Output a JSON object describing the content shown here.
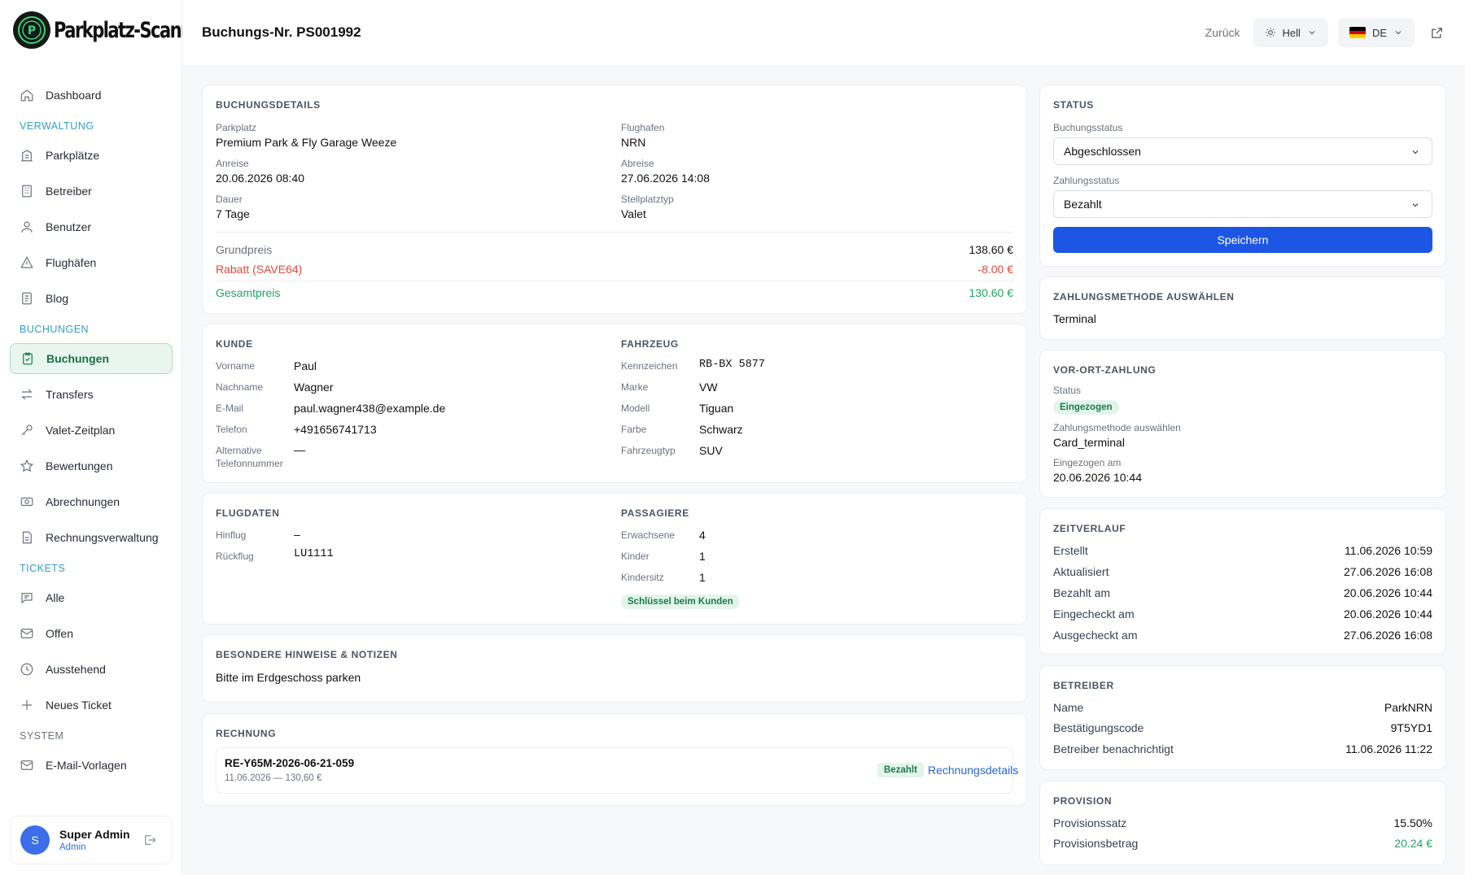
{
  "app": {
    "name": "Parkplatz-Scanner"
  },
  "header": {
    "title": "Buchungs-Nr. PS001992",
    "back": "Zurück",
    "theme": "Hell",
    "lang": "DE"
  },
  "sidebar": {
    "items": [
      {
        "label": "Dashboard"
      },
      {
        "section": "VERWALTUNG"
      },
      {
        "label": "Parkplätze"
      },
      {
        "label": "Betreiber"
      },
      {
        "label": "Benutzer"
      },
      {
        "label": "Flughäfen"
      },
      {
        "label": "Blog"
      },
      {
        "section": "BUCHUNGEN"
      },
      {
        "label": "Buchungen"
      },
      {
        "label": "Transfers"
      },
      {
        "label": "Valet-Zeitplan"
      },
      {
        "label": "Bewertungen"
      },
      {
        "label": "Abrechnungen"
      },
      {
        "label": "Rechnungsverwaltung"
      },
      {
        "section": "TICKETS"
      },
      {
        "label": "Alle"
      },
      {
        "label": "Offen"
      },
      {
        "label": "Ausstehend"
      },
      {
        "label": "Neues Ticket"
      },
      {
        "section": "SYSTEM"
      },
      {
        "label": "E-Mail-Vorlagen"
      }
    ],
    "user": {
      "initial": "S",
      "name": "Super Admin",
      "role": "Admin"
    }
  },
  "booking": {
    "title": "BUCHUNGSDETAILS",
    "parkplatz_label": "Parkplatz",
    "parkplatz": "Premium Park & Fly Garage Weeze",
    "flughafen_label": "Flughafen",
    "flughafen": "NRN",
    "anreise_label": "Anreise",
    "anreise": "20.06.2026 08:40",
    "abreise_label": "Abreise",
    "abreise": "27.06.2026 14:08",
    "dauer_label": "Dauer",
    "dauer": "7 Tage",
    "stellplatz_label": "Stellplatztyp",
    "stellplatz": "Valet",
    "grundpreis_label": "Grundpreis",
    "grundpreis": "138.60 €",
    "rabatt_label": "Rabatt (SAVE64)",
    "rabatt": "-8.00 €",
    "gesamt_label": "Gesamtpreis",
    "gesamt": "130.60 €"
  },
  "kunde": {
    "title": "KUNDE",
    "vorname_label": "Vorname",
    "vorname": "Paul",
    "nachname_label": "Nachname",
    "nachname": "Wagner",
    "email_label": "E-Mail",
    "email": "paul.wagner438@example.de",
    "telefon_label": "Telefon",
    "telefon": "+491656741713",
    "alt_label_1": "Alternative",
    "alt_label_2": "Telefonnummer",
    "alt": "—"
  },
  "fahrzeug": {
    "title": "FAHRZEUG",
    "kennzeichen_label": "Kennzeichen",
    "kennzeichen": "RB-BX 5877",
    "marke_label": "Marke",
    "marke": "VW",
    "modell_label": "Modell",
    "modell": "Tiguan",
    "farbe_label": "Farbe",
    "farbe": "Schwarz",
    "typ_label": "Fahrzeugtyp",
    "typ": "SUV"
  },
  "flug": {
    "title": "FLUGDATEN",
    "hinflug_label": "Hinflug",
    "hinflug": "–",
    "rueckflug_label": "Rückflug",
    "rueckflug": "LU1111"
  },
  "passagiere": {
    "title": "PASSAGIERE",
    "erw_label": "Erwachsene",
    "erw": "4",
    "kinder_label": "Kinder",
    "kinder": "1",
    "sitz_label": "Kindersitz",
    "sitz": "1",
    "badge": "Schlüssel beim Kunden"
  },
  "notes": {
    "title": "BESONDERE HINWEISE & NOTIZEN",
    "text": "Bitte im Erdgeschoss parken"
  },
  "rechnung": {
    "title": "RECHNUNG",
    "nr": "RE-Y65M-2026-06-21-059",
    "sub": "11.06.2026 — 130,60 €",
    "badge": "Bezahlt",
    "link": "Rechnungsdetails"
  },
  "status": {
    "title": "STATUS",
    "buchung_label": "Buchungsstatus",
    "buchung": "Abgeschlossen",
    "zahlung_label": "Zahlungsstatus",
    "zahlung": "Bezahlt",
    "save": "Speichern"
  },
  "methode": {
    "title": "ZAHLUNGSMETHODE AUSWÄHLEN",
    "value": "Terminal"
  },
  "vorort": {
    "title": "VOR-ORT-ZAHLUNG",
    "status_label": "Status",
    "status": "Eingezogen",
    "methode_label": "Zahlungsmethode auswählen",
    "methode": "Card_terminal",
    "am_label": "Eingezogen am",
    "am": "20.06.2026 10:44"
  },
  "zeit": {
    "title": "ZEITVERLAUF",
    "rows": [
      {
        "k": "Erstellt",
        "v": "11.06.2026 10:59"
      },
      {
        "k": "Aktualisiert",
        "v": "27.06.2026 16:08"
      },
      {
        "k": "Bezahlt am",
        "v": "20.06.2026 10:44"
      },
      {
        "k": "Eingecheckt am",
        "v": "20.06.2026 10:44"
      },
      {
        "k": "Ausgecheckt am",
        "v": "27.06.2026 16:08"
      }
    ]
  },
  "betreiber": {
    "title": "BETREIBER",
    "rows": [
      {
        "k": "Name",
        "v": "ParkNRN"
      },
      {
        "k": "Bestätigungscode",
        "v": "9T5YD1"
      },
      {
        "k": "Betreiber benachrichtigt",
        "v": "11.06.2026 11:22"
      }
    ]
  },
  "provision": {
    "title": "PROVISION",
    "satz_label": "Provisionssatz",
    "satz": "15.50%",
    "betrag_label": "Provisionsbetrag",
    "betrag": "20.24 €"
  },
  "colors": {
    "accent": "#1d56e5",
    "success": "#22a565",
    "danger": "#e5483c",
    "section": "#30a0c9"
  }
}
